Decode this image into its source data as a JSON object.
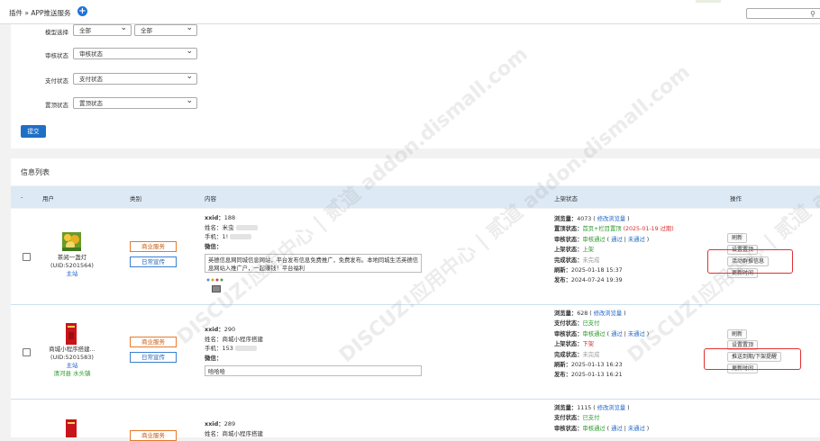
{
  "header": {
    "breadcrumb": "插件 » APP推送服务",
    "add_icon": "plus-circle-icon",
    "search_icon": "search-icon"
  },
  "filters": {
    "model": {
      "label": "模型选择",
      "value1": "全部",
      "value2": "全部"
    },
    "review": {
      "label": "审核状态",
      "value": "审核状态"
    },
    "payment": {
      "label": "支付状态",
      "value": "支付状态"
    },
    "pin": {
      "label": "置顶状态",
      "value": "置顶状态"
    },
    "submit_label": "提交"
  },
  "list": {
    "title": "信息列表",
    "columns": [
      "-",
      "用户",
      "类别",
      "内容",
      "上架状态",
      "操作"
    ]
  },
  "rows": [
    {
      "user": {
        "name": "茶阅一盏灯",
        "uid": "(UID:5201564)",
        "site": "主站",
        "area": ""
      },
      "categories": [
        "商业服务",
        "日常宣传"
      ],
      "content": {
        "xxid_label": "xxid：",
        "xxid": "188",
        "name_label": "姓名：",
        "name": "米虫",
        "phone_label": "手机：",
        "phone": "1!",
        "wechat_label": "微信：",
        "desc": "英德信息网同城信息网站，平台发布信息免费推广，免费发布。本地同城生活英德信息网站入推广户，一起赚钱！平台福利"
      },
      "status": {
        "views_label": "浏览量：",
        "views": "4073",
        "views_edit": "修改浏览量",
        "pin_label": "置顶状态：",
        "pin": "首页+栏目置顶",
        "pin_expire": "(2025-01-19 过期)",
        "review_label": "审核状态：",
        "review": "审核通过",
        "review_pass": "通过",
        "review_fail": "未通过",
        "shelf_label": "上架状态：",
        "shelf": "上架",
        "done_label": "完成状态：",
        "done": "未完成",
        "refresh_label": "刷新：",
        "refresh": "2025-01-18 15:37",
        "publish_label": "发布：",
        "publish": "2024-07-24 19:39"
      },
      "ops": [
        "刷新",
        "设置置顶",
        "活动群推信息",
        "更新时间"
      ]
    },
    {
      "user": {
        "name": "商城小程序搭建...",
        "uid": "(UID:5201583)",
        "site": "主站",
        "area": "清河县 水头镇"
      },
      "categories": [
        "商业服务",
        "日常宣传"
      ],
      "content": {
        "xxid_label": "xxid：",
        "xxid": "290",
        "name_label": "姓名：",
        "name": "商城小程序搭建",
        "phone_label": "手机：",
        "phone": "153",
        "wechat_label": "微信：",
        "desc": "哈哈哈"
      },
      "status": {
        "views_label": "浏览量：",
        "views": "628",
        "views_edit": "修改浏览量",
        "pay_label": "支付状态：",
        "pay": "已支付",
        "review_label": "审核状态：",
        "review": "审核通过",
        "review_pass": "通过",
        "review_fail": "未通过",
        "shelf_label": "上架状态：",
        "shelf": "下架",
        "done_label": "完成状态：",
        "done": "未完成",
        "refresh_label": "刷新：",
        "refresh": "2025-01-13 16:23",
        "publish_label": "发布：",
        "publish": "2025-01-13 16:21"
      },
      "ops": [
        "刷新",
        "设置置顶",
        "推送到期/下架提醒",
        "更新时间"
      ]
    },
    {
      "user": {
        "name": "",
        "uid": "",
        "site": "",
        "area": ""
      },
      "categories": [
        "商业服务"
      ],
      "content": {
        "xxid_label": "xxid：",
        "xxid": "289",
        "name_label": "姓名：",
        "name": "商城小程序搭建"
      },
      "status": {
        "views_label": "浏览量：",
        "views": "1115",
        "views_edit": "修改浏览量",
        "pay_label": "支付状态：",
        "pay": "已支付",
        "review_label": "审核状态：",
        "review": "审核通过",
        "review_pass": "通过",
        "review_fail": "未通过"
      }
    }
  ],
  "watermark": "DISCUZ!应用中心 | 贰道 addon.dismall.com",
  "colors": {
    "primary": "#1f6fc5",
    "success": "#2b9a2b",
    "danger": "#d82a2a",
    "accent": "#e67a2a",
    "header_bg": "#dde9f5"
  }
}
